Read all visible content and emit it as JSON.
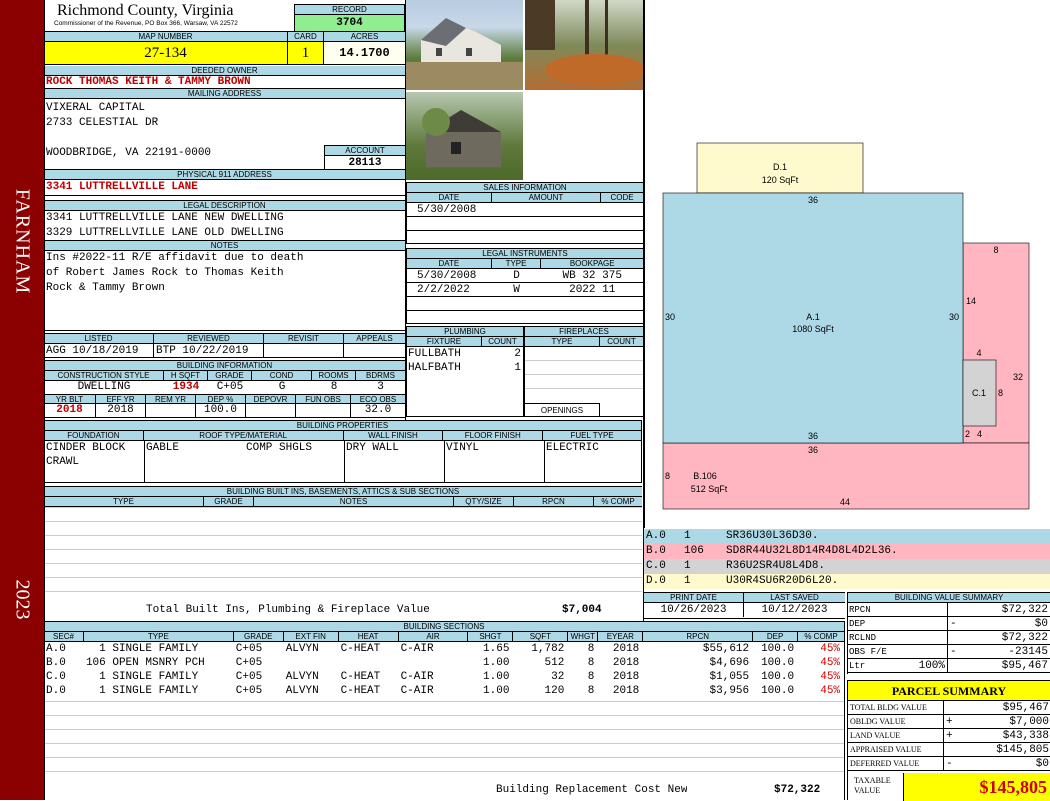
{
  "side": {
    "district": "FARNHAM",
    "year": "2023"
  },
  "header": {
    "county": "Richmond County, Virginia",
    "address": "Commissioner of the Revenue, PO Box 366, Warsaw, VA 22572",
    "record_label": "RECORD",
    "record": "3704",
    "map_label": "MAP NUMBER",
    "map": "27-134",
    "card_label": "CARD",
    "card": "1",
    "acres_label": "ACRES",
    "acres": "14.1700"
  },
  "owner": {
    "label": "DEEDED OWNER",
    "name": "ROCK THOMAS KEITH & TAMMY BROWN",
    "mail_label": "MAILING ADDRESS",
    "mail1": "VIXERAL CAPITAL",
    "mail2": "2733 CELESTIAL DR",
    "mail3": "WOODBRIDGE, VA 22191-0000",
    "account_label": "ACCOUNT",
    "account": "28113"
  },
  "physical": {
    "label": "PHYSICAL 911 ADDRESS",
    "value": "3341 LUTTRELLVILLE LANE"
  },
  "legal": {
    "label": "LEGAL DESCRIPTION",
    "l1": "3341 LUTTRELLVILLE LANE NEW DWELLING",
    "l2": "3329 LUTTRELLVILLE LANE OLD DWELLING"
  },
  "notes": {
    "label": "NOTES",
    "l1": "Ins #2022-11 R/E affidavit due to death",
    "l2": "of Robert James Rock to Thomas Keith",
    "l3": "Rock & Tammy Brown"
  },
  "review": {
    "h": [
      "LISTED",
      "REVIEWED",
      "REVISIT",
      "APPEALS"
    ],
    "listed": "AGG 10/18/2019",
    "reviewed": "BTP 10/22/2019",
    "revisit": "",
    "appeals": ""
  },
  "building": {
    "label": "BUILDING INFORMATION",
    "h1": [
      "CONSTRUCTION STYLE",
      "H SQFT",
      "GRADE",
      "COND",
      "ROOMS",
      "BDRMS"
    ],
    "style": "DWELLING",
    "hsqft": "1934",
    "grade": "C+05",
    "cond": "G",
    "rooms": "8",
    "bdrms": "3",
    "h2": [
      "YR BLT",
      "EFF YR",
      "REM YR",
      "DEP %",
      "DEPOVR",
      "FUN OBS",
      "ECO OBS"
    ],
    "yrblt": "2018",
    "effyr": "2018",
    "remyr": "",
    "dep": "100.0",
    "depovr": "",
    "funobs": "",
    "ecoobs": "32.0"
  },
  "props": {
    "label": "BUILDING PROPERTIES",
    "h": [
      "FOUNDATION",
      "ROOF TYPE/MATERIAL",
      "WALL FINISH",
      "FLOOR FINISH",
      "FUEL TYPE"
    ],
    "found1": "CINDER BLOCK",
    "found2": "CRAWL",
    "roof1": "GABLE",
    "roof2": "COMP SHGLS",
    "wall": "DRY WALL",
    "floor": "VINYL",
    "fuel": "ELECTRIC"
  },
  "builtins": {
    "label": "BUILDING BUILT INS, BASEMENTS, ATTICS & SUB SECTIONS",
    "h": [
      "TYPE",
      "GRADE",
      "NOTES",
      "QTY/SIZE",
      "RPCN",
      "% COMP"
    ],
    "total_label": "Total Built Ins, Plumbing & Fireplace Value",
    "total": "$7,004"
  },
  "sales": {
    "label": "SALES INFORMATION",
    "h": [
      "DATE",
      "AMOUNT",
      "CODE"
    ],
    "rows": [
      {
        "date": "5/30/2008",
        "amount": "",
        "code": ""
      }
    ]
  },
  "instruments": {
    "label": "LEGAL INSTRUMENTS",
    "h": [
      "DATE",
      "TYPE",
      "BOOKPAGE"
    ],
    "rows": [
      {
        "date": "5/30/2008",
        "type": "D",
        "book": "WB 32 375"
      },
      {
        "date": "2/2/2022",
        "type": "W",
        "book": "2022 11"
      }
    ]
  },
  "plumbing": {
    "label": "PLUMBING",
    "h": [
      "FIXTURE",
      "COUNT"
    ],
    "rows": [
      {
        "f": "FULLBATH",
        "c": "2"
      },
      {
        "f": "HALFBATH",
        "c": "1"
      }
    ]
  },
  "fireplaces": {
    "label": "FIREPLACES",
    "h": [
      "TYPE",
      "COUNT"
    ],
    "openings": "OPENINGS"
  },
  "sketch": {
    "d1": "D.1",
    "d1a": "120 SqFt",
    "a1": "A.1",
    "a1a": "1080 SqFt",
    "b106": "B.106",
    "b106a": "512 SqFt",
    "c1": "C.1",
    "dims": {
      "d_bottom": "36",
      "a_left": "30",
      "a_right": "30",
      "a_bottom": "36",
      "b_top": "36",
      "b_left": "8",
      "b_bottom": "44",
      "pink_top": "8",
      "pink_right": "32",
      "pink_14": "14",
      "c_top": "4",
      "c_right": "8",
      "c_2": "2",
      "c_4": "4"
    }
  },
  "codes": [
    {
      "k": "A.0",
      "n": "1",
      "v": "SR36U30L36D30."
    },
    {
      "k": "B.0",
      "n": "106",
      "v": "SD8R44U32L8D14R4D8L4D2L36."
    },
    {
      "k": "C.0",
      "n": "1",
      "v": "R36U2SR4U8L4D8."
    },
    {
      "k": "D.0",
      "n": "1",
      "v": "U30R4SU6R20D6L20."
    }
  ],
  "dates": {
    "print_label": "PRINT DATE",
    "print": "10/26/2023",
    "saved_label": "LAST SAVED",
    "saved": "10/12/2023"
  },
  "bvs": {
    "label": "BUILDING VALUE SUMMARY",
    "rows": [
      {
        "k": "RPCN",
        "s": "",
        "v": "$72,322"
      },
      {
        "k": "DEP",
        "s": "-",
        "v": "$0"
      },
      {
        "k": "RCLND",
        "s": "",
        "v": "$72,322"
      },
      {
        "k": "OBS F/E",
        "s": "-",
        "v": "-23145"
      },
      {
        "k": "Ltr",
        "s": "100%",
        "v": "$95,467"
      }
    ]
  },
  "sections": {
    "label": "BUILDING SECTIONS",
    "h": [
      "SEC#",
      "TYPE",
      "GRADE",
      "EXT FIN",
      "HEAT",
      "AIR",
      "SHGT",
      "SQFT",
      "WHGT",
      "EYEAR",
      "RPCN",
      "DEP",
      "% COMP"
    ],
    "rows": [
      {
        "sec": "A.0",
        "type": "  1 SINGLE FAMILY",
        "grade": "C+05",
        "ext": "ALVYN",
        "heat": "C-HEAT",
        "air": "C-AIR",
        "shgt": "1.65",
        "sqft": "1,782",
        "whgt": "8",
        "eyear": "2018",
        "rpcn": "$55,612",
        "dep": "100.0",
        "comp": "45%"
      },
      {
        "sec": "B.0",
        "type": "106 OPEN MSNRY PCH",
        "grade": "C+05",
        "ext": "",
        "heat": "",
        "air": "",
        "shgt": "1.00",
        "sqft": "512",
        "whgt": "8",
        "eyear": "2018",
        "rpcn": "$4,696",
        "dep": "100.0",
        "comp": "45%"
      },
      {
        "sec": "C.0",
        "type": "  1 SINGLE FAMILY",
        "grade": "C+05",
        "ext": "ALVYN",
        "heat": "C-HEAT",
        "air": "C-AIR",
        "shgt": "1.00",
        "sqft": "32",
        "whgt": "8",
        "eyear": "2018",
        "rpcn": "$1,055",
        "dep": "100.0",
        "comp": "45%"
      },
      {
        "sec": "D.0",
        "type": "  1 SINGLE FAMILY",
        "grade": "C+05",
        "ext": "ALVYN",
        "heat": "C-HEAT",
        "air": "C-AIR",
        "shgt": "1.00",
        "sqft": "120",
        "whgt": "8",
        "eyear": "2018",
        "rpcn": "$3,956",
        "dep": "100.0",
        "comp": "45%"
      }
    ],
    "total_label": "Building Replacement Cost New",
    "total": "$72,322"
  },
  "parcel": {
    "label": "PARCEL SUMMARY",
    "rows": [
      {
        "k": "TOTAL BLDG VALUE",
        "s": "",
        "v": "$95,467"
      },
      {
        "k": "OBLDG VALUE",
        "s": "+",
        "v": "$7,000"
      },
      {
        "k": "LAND VALUE",
        "s": "+",
        "v": "$43,338"
      },
      {
        "k": "APPRAISED VALUE",
        "s": "",
        "v": "$145,805"
      },
      {
        "k": "DEFERRED VALUE",
        "s": "-",
        "v": "$0"
      }
    ],
    "taxable_label1": "TAXABLE",
    "taxable_label2": "VALUE",
    "taxable": "$145,805"
  },
  "colors": {
    "sidebar": "#8b0000",
    "header_bar": "#add8e6",
    "highlight": "#ffff00",
    "record_bg": "#90ee90",
    "sketch_a": "#add8e6",
    "sketch_b": "#ffb6c1",
    "sketch_c": "#d3d3d3",
    "sketch_d": "#fffacd"
  }
}
